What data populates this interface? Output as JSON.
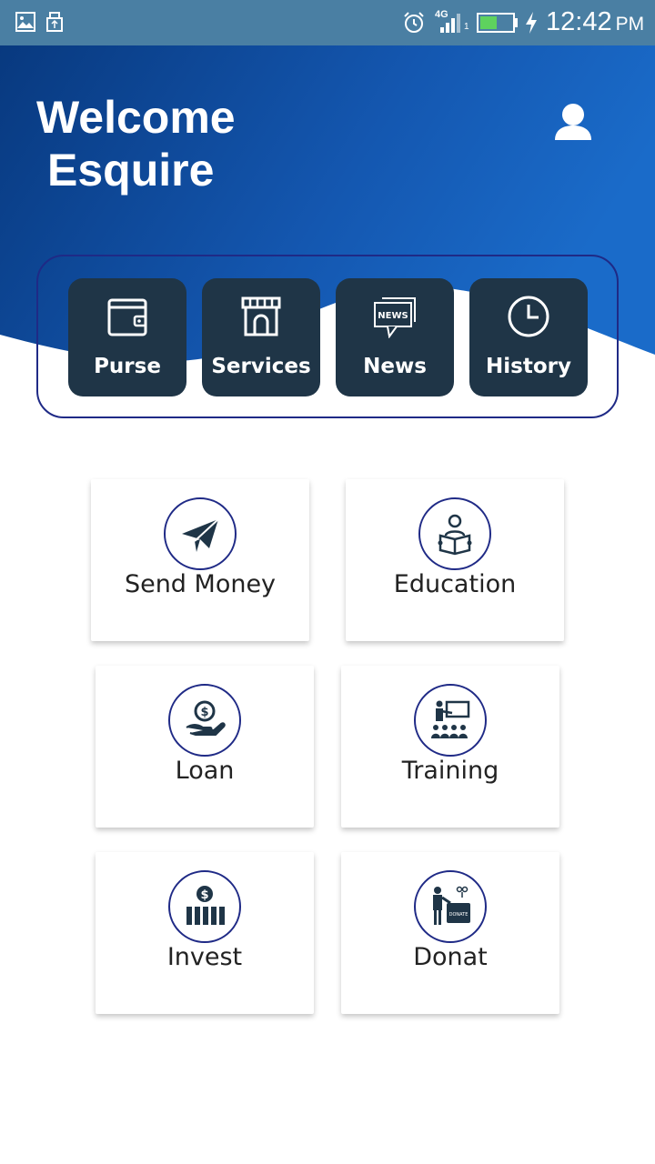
{
  "status_bar": {
    "time": "12:42",
    "ampm": "PM",
    "network": "4G",
    "sim": "1",
    "icons": [
      "gallery-icon",
      "usb-icon",
      "alarm-icon",
      "signal-icon",
      "battery-icon",
      "charging-icon"
    ]
  },
  "header": {
    "welcome_line1": "Welcome",
    "welcome_line2": "Esquire",
    "profile_icon": "user-icon",
    "gradient": [
      "#0a3f8e",
      "#1a68c8"
    ]
  },
  "quick_actions": [
    {
      "label": "Purse",
      "icon": "wallet-icon"
    },
    {
      "label": "Services",
      "icon": "store-icon"
    },
    {
      "label": "News",
      "icon": "news-icon",
      "icon_text": "NEWS"
    },
    {
      "label": "History",
      "icon": "clock-icon"
    }
  ],
  "services": [
    {
      "label": "Send Money",
      "icon": "paper-plane-icon"
    },
    {
      "label": "Education",
      "icon": "student-reading-icon"
    },
    {
      "label": "Loan",
      "icon": "hand-coin-icon"
    },
    {
      "label": "Training",
      "icon": "presentation-icon"
    },
    {
      "label": "Invest",
      "icon": "invest-bars-icon"
    },
    {
      "label": "Donat",
      "icon": "donate-icon",
      "icon_text": "DONATE"
    }
  ],
  "colors": {
    "status_bar": "#4a7fa3",
    "tile": "#1f3547",
    "accent_border": "#1f2a86",
    "icon_dark": "#1f3547"
  }
}
